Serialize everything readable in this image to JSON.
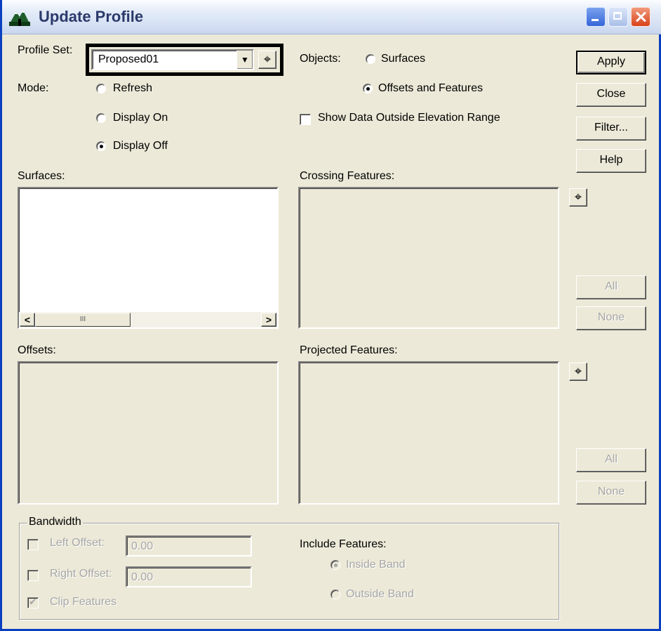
{
  "window": {
    "title": "Update Profile",
    "icon": "mountain-app-icon"
  },
  "profile_set": {
    "label": "Profile Set:",
    "value": "Proposed01"
  },
  "mode": {
    "label": "Mode:",
    "options": [
      "Refresh",
      "Display On",
      "Display Off"
    ],
    "selected": "Display Off"
  },
  "objects": {
    "label": "Objects:",
    "options": [
      "Surfaces",
      "Offsets and Features"
    ],
    "selected": "Offsets and Features"
  },
  "show_outside": {
    "label": "Show Data Outside Elevation Range",
    "checked": false
  },
  "buttons": {
    "apply": "Apply",
    "close": "Close",
    "filter": "Filter...",
    "help": "Help"
  },
  "surfaces": {
    "label": "Surfaces:",
    "items": []
  },
  "crossing_features": {
    "label": "Crossing Features:",
    "items": [],
    "all": "All",
    "none": "None"
  },
  "offsets": {
    "label": "Offsets:",
    "items": []
  },
  "projected_features": {
    "label": "Projected Features:",
    "items": [],
    "all": "All",
    "none": "None"
  },
  "bandwidth": {
    "legend": "Bandwidth",
    "left_offset_label": "Left Offset:",
    "left_offset_value": "0.00",
    "right_offset_label": "Right Offset:",
    "right_offset_value": "0.00",
    "clip_features_label": "Clip Features",
    "clip_features_checked": true
  },
  "include_features": {
    "label": "Include Features:",
    "options": [
      "Inside Band",
      "Outside Band"
    ],
    "selected": "Inside Band"
  },
  "scrollbar_grip": "III",
  "highlight_color": "#000000"
}
